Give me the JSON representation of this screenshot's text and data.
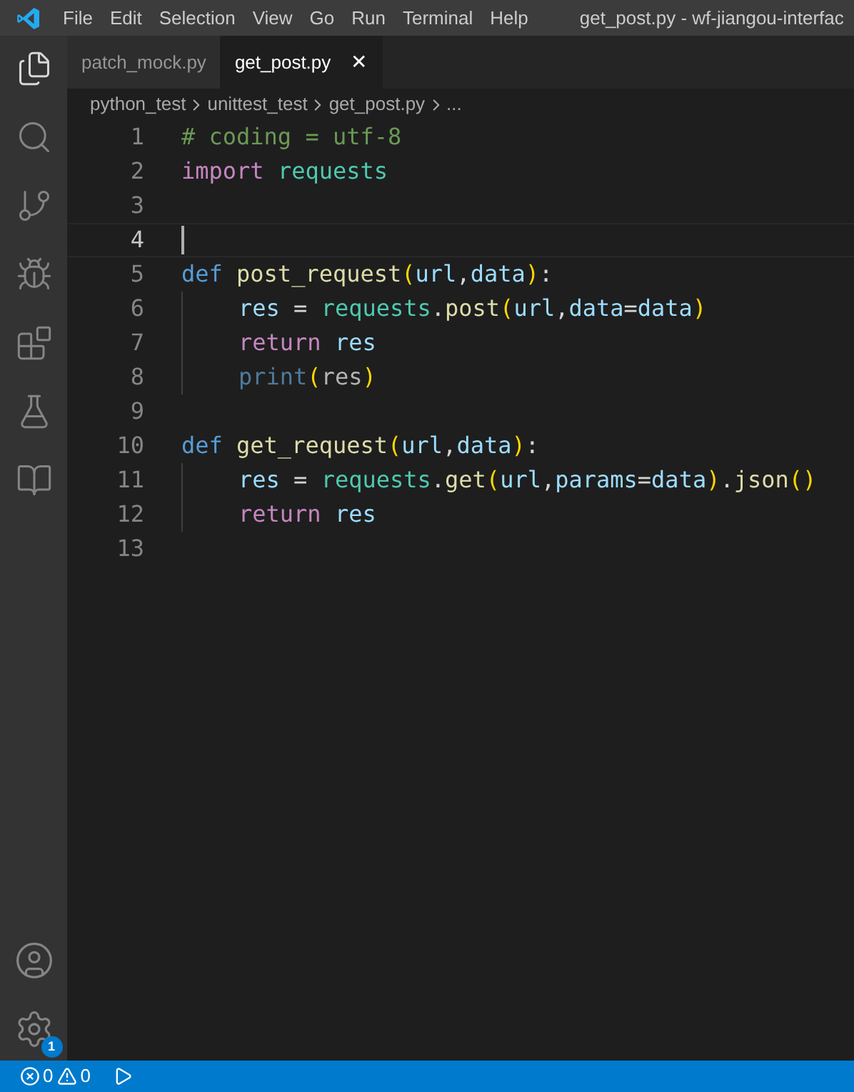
{
  "menu_bar": {
    "items": [
      "File",
      "Edit",
      "Selection",
      "View",
      "Go",
      "Run",
      "Terminal",
      "Help"
    ],
    "title": "get_post.py - wf-jiangou-interfac"
  },
  "activity_bar": {
    "badge": "1"
  },
  "tabs": [
    {
      "label": "patch_mock.py",
      "selected": false
    },
    {
      "label": "get_post.py",
      "selected": true,
      "close": "✕"
    }
  ],
  "breadcrumb": [
    "python_test",
    "unittest_test",
    "get_post.py",
    "..."
  ],
  "editor": {
    "lines": [
      {
        "number": "1",
        "current": false,
        "indented": false,
        "tokens": [
          {
            "text": "# coding = utf-8",
            "kind": "comment"
          }
        ]
      },
      {
        "number": "2",
        "current": false,
        "indented": false,
        "tokens": [
          {
            "text": "import ",
            "kind": "control"
          },
          {
            "text": "requests",
            "kind": "module"
          }
        ]
      },
      {
        "number": "3",
        "current": false,
        "indented": false
      },
      {
        "number": "4",
        "current": true,
        "indented": false
      },
      {
        "number": "5",
        "current": false,
        "indented": false,
        "tokens": [
          {
            "text": "def ",
            "kind": "keyword"
          },
          {
            "text": "post_request",
            "kind": "function"
          },
          {
            "text": "(",
            "kind": "paren"
          },
          {
            "text": "url",
            "kind": "variable"
          },
          {
            "text": ",",
            "kind": "plain"
          },
          {
            "text": "data",
            "kind": "variable"
          },
          {
            "text": ")",
            "kind": "paren"
          },
          {
            "text": ":",
            "kind": "plain"
          }
        ]
      },
      {
        "number": "6",
        "current": false,
        "indented": true,
        "tokens": [
          {
            "text": "res",
            "kind": "variable"
          },
          {
            "text": " = ",
            "kind": "plain"
          },
          {
            "text": "requests",
            "kind": "module"
          },
          {
            "text": ".",
            "kind": "plain"
          },
          {
            "text": "post",
            "kind": "function"
          },
          {
            "text": "(",
            "kind": "paren"
          },
          {
            "text": "url",
            "kind": "variable"
          },
          {
            "text": ",",
            "kind": "plain"
          },
          {
            "text": "data",
            "kind": "variable"
          },
          {
            "text": "=",
            "kind": "plain"
          },
          {
            "text": "data",
            "kind": "variable"
          },
          {
            "text": ")",
            "kind": "paren"
          }
        ]
      },
      {
        "number": "7",
        "current": false,
        "indented": true,
        "tokens": [
          {
            "text": "return ",
            "kind": "control"
          },
          {
            "text": "res",
            "kind": "variable"
          }
        ]
      },
      {
        "number": "8",
        "current": false,
        "indented": true,
        "tokens": [
          {
            "text": "print",
            "kind": "faded"
          },
          {
            "text": "(",
            "kind": "paren"
          },
          {
            "text": "res",
            "kind": "faded-plain"
          },
          {
            "text": ")",
            "kind": "paren"
          }
        ]
      },
      {
        "number": "9",
        "current": false,
        "indented": false
      },
      {
        "number": "10",
        "current": false,
        "indented": false,
        "tokens": [
          {
            "text": "def ",
            "kind": "keyword"
          },
          {
            "text": "get_request",
            "kind": "function"
          },
          {
            "text": "(",
            "kind": "paren"
          },
          {
            "text": "url",
            "kind": "variable"
          },
          {
            "text": ",",
            "kind": "plain"
          },
          {
            "text": "data",
            "kind": "variable"
          },
          {
            "text": ")",
            "kind": "paren"
          },
          {
            "text": ":",
            "kind": "plain"
          }
        ]
      },
      {
        "number": "11",
        "current": false,
        "indented": true,
        "tokens": [
          {
            "text": "res",
            "kind": "variable"
          },
          {
            "text": " = ",
            "kind": "plain"
          },
          {
            "text": "requests",
            "kind": "module"
          },
          {
            "text": ".",
            "kind": "plain"
          },
          {
            "text": "get",
            "kind": "function"
          },
          {
            "text": "(",
            "kind": "paren"
          },
          {
            "text": "url",
            "kind": "variable"
          },
          {
            "text": ",",
            "kind": "plain"
          },
          {
            "text": "params",
            "kind": "variable"
          },
          {
            "text": "=",
            "kind": "plain"
          },
          {
            "text": "data",
            "kind": "variable"
          },
          {
            "text": ")",
            "kind": "paren"
          },
          {
            "text": ".",
            "kind": "plain"
          },
          {
            "text": "json",
            "kind": "function"
          },
          {
            "text": "()",
            "kind": "paren"
          }
        ]
      },
      {
        "number": "12",
        "current": false,
        "indented": true,
        "tokens": [
          {
            "text": "return ",
            "kind": "control"
          },
          {
            "text": "res",
            "kind": "variable"
          }
        ]
      },
      {
        "number": "13",
        "current": false,
        "indented": false
      }
    ]
  },
  "status_bar": {
    "errors": "0",
    "warnings": "0"
  }
}
